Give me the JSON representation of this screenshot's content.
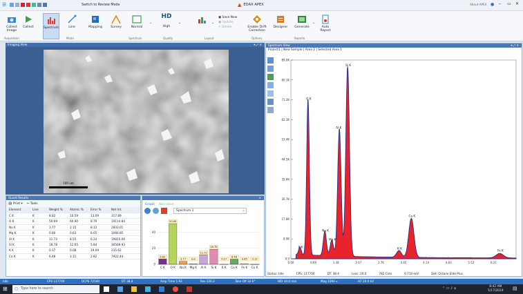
{
  "title": {
    "center": "EDAX APEX",
    "switch_mode": "Switch to Review Mode",
    "about": "About APEX",
    "user": "Apex User"
  },
  "ribbon": {
    "buttons": [
      {
        "key": "collect_image",
        "label": "Collect Image"
      },
      {
        "key": "collect",
        "label": "Collect"
      },
      {
        "key": "spectrum",
        "label": "Spectrum"
      },
      {
        "key": "line",
        "label": "Line"
      },
      {
        "key": "mapping",
        "label": "Mapping"
      },
      {
        "key": "survey",
        "label": "Survey"
      },
      {
        "key": "normal",
        "label": "Normal"
      },
      {
        "key": "hd_high",
        "label": "High"
      },
      {
        "key": "layout",
        "label": ""
      },
      {
        "key": "enable_drift",
        "label": "Enable Drift Correction"
      },
      {
        "key": "designer",
        "label": "Designer"
      },
      {
        "key": "generate",
        "label": "Generate"
      },
      {
        "key": "auto_report",
        "label": "Auto Report"
      }
    ],
    "small": {
      "save_new": "Save New",
      "update": "Update",
      "delete": "Delete"
    },
    "groups": {
      "acquisition": "Acquisition",
      "mode": "Mode",
      "spectrum": "Spectrum",
      "quality": "Quality",
      "layout": "Layout",
      "options": "Options",
      "reports": "Reports"
    },
    "hd": "HD"
  },
  "imaging": {
    "header": "Imaging View",
    "scale_label": "100 um"
  },
  "quant": {
    "header": "Quant Results",
    "toolbar": {
      "print": "Print",
      "tools": "Tools"
    },
    "columns": [
      "Element",
      "Line",
      "Weight %",
      "Atomic %",
      "Error %",
      "Net Int."
    ],
    "rows": [
      [
        "C K",
        "K",
        "8.82",
        "10.59",
        "13.09",
        "317.89"
      ],
      [
        "O K",
        "K",
        "50.69",
        "60.90",
        "8.79",
        "19114.84"
      ],
      [
        "Na K",
        "K",
        "3.77",
        "2.15",
        "8.13",
        "2833.01"
      ],
      [
        "Mg K",
        "K",
        "0.80",
        "0.63",
        "8.65",
        "1066.85"
      ],
      [
        "Al K",
        "K",
        "11.73",
        "8.55",
        "6.24",
        "19815.06"
      ],
      [
        "Si K",
        "K",
        "18.78",
        "12.65",
        "5.84",
        "30569.93"
      ],
      [
        "K K",
        "K",
        "0.17",
        "0.08",
        "19.09",
        "235.62"
      ],
      [
        "Ca K",
        "K",
        "6.48",
        "3.11",
        "2.82",
        "7922.44"
      ]
    ]
  },
  "graph": {
    "tabs": {
      "graph": "Graph",
      "narrative": "Narrative"
    },
    "spectrum_select": "Spectrum 1",
    "chart_data": {
      "type": "bar",
      "categories": [
        "C K",
        "O K",
        "Na K",
        "Mg K",
        "Al K",
        "Si K",
        "K K",
        "Ca K",
        "Fe K",
        "Cu K"
      ],
      "values": [
        6.62,
        50.69,
        3.77,
        0.8,
        11.73,
        18.78,
        0.17,
        6.48,
        0.85,
        0.12
      ],
      "value_labels": [
        "6.62",
        "50.69",
        "3.77",
        "0.8",
        "11.72",
        "18.78",
        "0.17",
        "6.48",
        "0.85",
        "0.12"
      ],
      "yticks": [
        "0",
        "20",
        "40"
      ],
      "ylim": [
        0,
        55
      ],
      "colors": [
        "#7b2f8a",
        "#b6d35a",
        "#f2a14a",
        "#9fc0e6",
        "#c7a6df",
        "#e08cb0",
        "#8fd0d8",
        "#6aa56a",
        "#e6c27a",
        "#c98a6a"
      ]
    }
  },
  "spectrum": {
    "header": "Spectrum View",
    "breadcrumb": "Project1 | New Sample | Area 2 | Selected Area 1",
    "status": "Status: Idle",
    "cps": "CPS: 117700",
    "dt": "DT: 38.4",
    "lsec": "Lsec: 20.0",
    "cnts": "782 Cnts",
    "kev": "0.710 keV",
    "det": "Det: Octane Elite Plus",
    "chart_data": {
      "type": "line",
      "x_ticks": [
        "0.00",
        "0.69",
        "1.38",
        "2.07",
        "2.76",
        "3.45",
        "4.14",
        "4.83",
        "5.52",
        "6.21"
      ],
      "y_ticks": [
        "0.0",
        "8.9K",
        "17.8K",
        "26.7K",
        "35.6K",
        "44.5K",
        "53.4K",
        "62.3K",
        "71.2K",
        "80.1K",
        "89.0K"
      ],
      "xlim": [
        0,
        6.9
      ],
      "ylim": [
        0,
        89000
      ],
      "peaks": [
        {
          "label": "C K",
          "x": 0.277,
          "y": 3500
        },
        {
          "label": "O K",
          "x": 0.525,
          "y": 70000
        },
        {
          "label": "Na K",
          "x": 1.041,
          "y": 11000
        },
        {
          "label": "Mg K",
          "x": 1.254,
          "y": 7000
        },
        {
          "label": "Al K",
          "x": 1.486,
          "y": 57000
        },
        {
          "label": "Si K",
          "x": 1.739,
          "y": 85000
        },
        {
          "label": "K K",
          "x": 3.312,
          "y": 3000
        },
        {
          "label": "Ca K",
          "x": 3.69,
          "y": 17500
        },
        {
          "label": "Fe K",
          "x": 6.4,
          "y": 2000
        }
      ],
      "fill": "#e8232b",
      "line": "#27308a"
    }
  },
  "statusbar": {
    "items": [
      "Idle",
      "CPS 117700",
      "OCPS 72540",
      "DT 38.4",
      "Amp Time 1.92",
      "Res 126.2",
      "Take Off 32.0°",
      "WD 10.0 mm",
      "Mag 1000 x",
      "HT 20.0 kV"
    ]
  },
  "taskbar": {
    "search_placeholder": "Type here to search",
    "time": "8:42 AM",
    "date": "5/17/2019"
  }
}
